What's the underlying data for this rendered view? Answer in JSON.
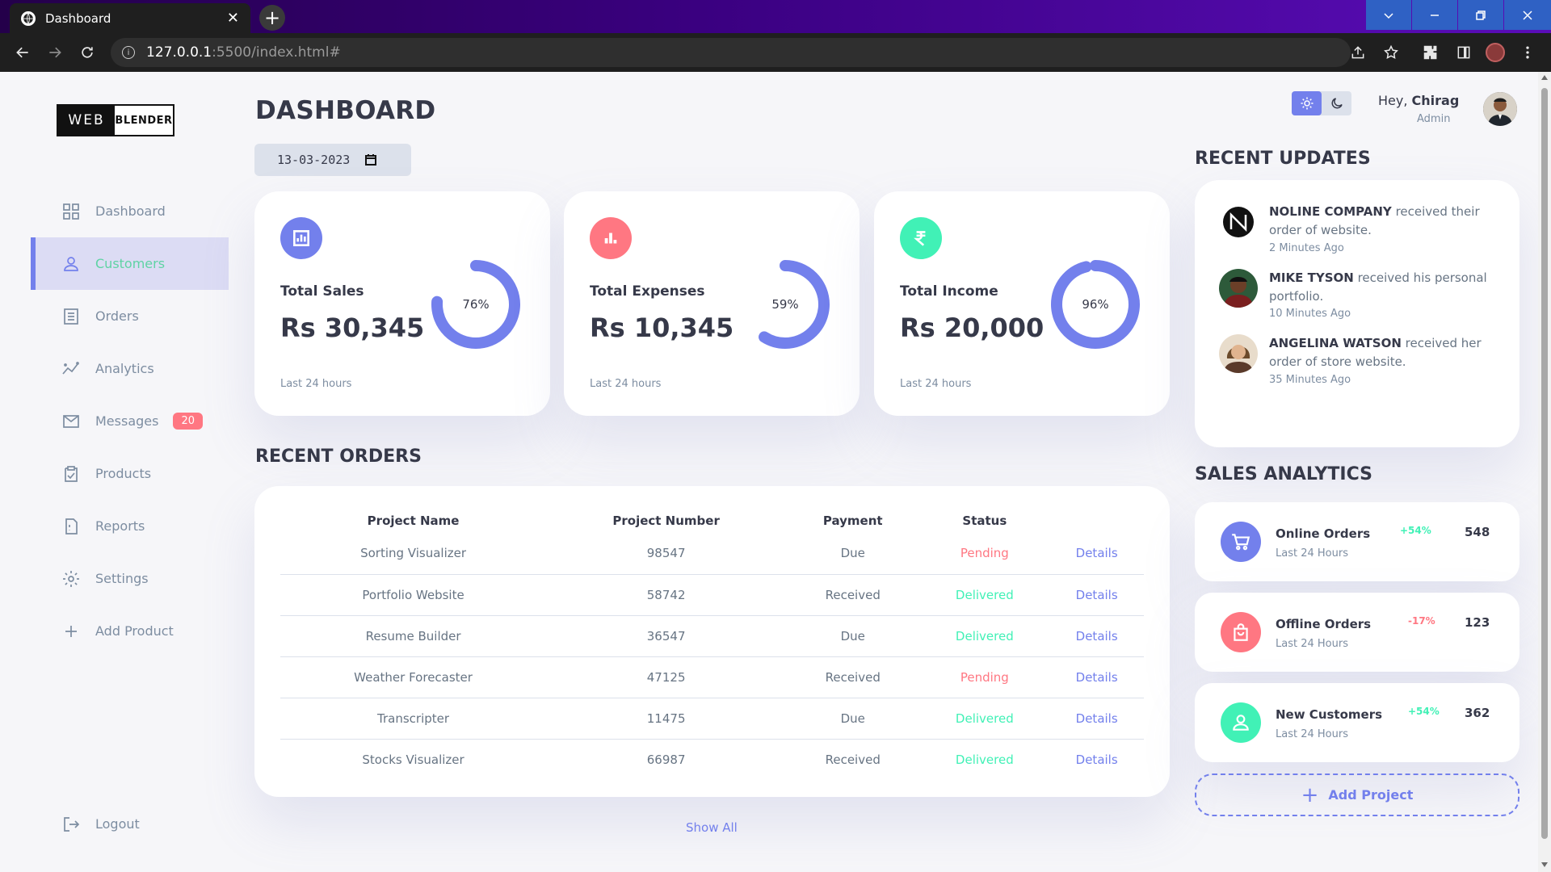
{
  "browser": {
    "tab_title": "Dashboard",
    "tab_close": "✕",
    "new_tab": "+",
    "url_host": "127.0.0.1",
    "url_path": ":5500/index.html#"
  },
  "logo": {
    "part1": "WEB",
    "part2": "BLENDER"
  },
  "sidebar": {
    "items": [
      {
        "label": "Dashboard",
        "icon": "grid-icon"
      },
      {
        "label": "Customers",
        "icon": "person-icon"
      },
      {
        "label": "Orders",
        "icon": "receipt-icon"
      },
      {
        "label": "Analytics",
        "icon": "insights-icon"
      },
      {
        "label": "Messages",
        "icon": "mail-icon",
        "badge": "20"
      },
      {
        "label": "Products",
        "icon": "inventory-icon"
      },
      {
        "label": "Reports",
        "icon": "report-icon"
      },
      {
        "label": "Settings",
        "icon": "gear-icon"
      },
      {
        "label": "Add Product",
        "icon": "plus-icon"
      }
    ],
    "active_index": 1,
    "logout": "Logout"
  },
  "main": {
    "title": "DASHBOARD",
    "date": "13-03-2023",
    "cards": [
      {
        "title": "Total Sales",
        "value": "Rs 30,345",
        "percent_label": "76%",
        "percent": 76,
        "footer": "Last 24 hours",
        "color": "#7380ec",
        "icon": "analytics-icon"
      },
      {
        "title": "Total Expenses",
        "value": "Rs 10,345",
        "percent_label": "59%",
        "percent": 59,
        "footer": "Last 24 hours",
        "color": "#ff7782",
        "icon": "bar-chart-icon"
      },
      {
        "title": "Total Income",
        "value": "Rs 20,000",
        "percent_label": "96%",
        "percent": 96,
        "footer": "Last 24 hours",
        "color": "#41f1b6",
        "icon": "rupee-icon"
      }
    ],
    "orders_title": "RECENT ORDERS",
    "orders_headers": [
      "Project Name",
      "Project Number",
      "Payment",
      "Status",
      ""
    ],
    "orders": [
      {
        "name": "Sorting Visualizer",
        "number": "98547",
        "payment": "Due",
        "status": "Pending",
        "details": "Details"
      },
      {
        "name": "Portfolio Website",
        "number": "58742",
        "payment": "Received",
        "status": "Delivered",
        "details": "Details"
      },
      {
        "name": "Resume Builder",
        "number": "36547",
        "payment": "Due",
        "status": "Delivered",
        "details": "Details"
      },
      {
        "name": "Weather Forecaster",
        "number": "47125",
        "payment": "Received",
        "status": "Pending",
        "details": "Details"
      },
      {
        "name": "Transcripter",
        "number": "11475",
        "payment": "Due",
        "status": "Delivered",
        "details": "Details"
      },
      {
        "name": "Stocks Visualizer",
        "number": "66987",
        "payment": "Received",
        "status": "Delivered",
        "details": "Details"
      }
    ],
    "show_all": "Show All"
  },
  "header": {
    "greeting": "Hey, ",
    "user_name": "Chirag",
    "role": "Admin"
  },
  "updates": {
    "title": "RECENT UPDATES",
    "items": [
      {
        "name": "NOLINE COMPANY",
        "text": " received their order of website.",
        "time": "2 Minutes Ago"
      },
      {
        "name": "MIKE TYSON",
        "text": " received his personal portfolio.",
        "time": "10 Minutes Ago"
      },
      {
        "name": "ANGELINA WATSON",
        "text": " received her order of store website.",
        "time": "35 Minutes Ago"
      }
    ]
  },
  "analytics": {
    "title": "SALES ANALYTICS",
    "items": [
      {
        "title": "Online Orders",
        "sub": "Last 24 Hours",
        "pct": "+54%",
        "value": "548",
        "color": "#7380ec",
        "pct_color": "#41f1b6",
        "icon": "cart-icon"
      },
      {
        "title": "Offline Orders",
        "sub": "Last 24 Hours",
        "pct": "-17%",
        "value": "123",
        "color": "#ff7782",
        "pct_color": "#ff7782",
        "icon": "shopping-bag-icon"
      },
      {
        "title": "New Customers",
        "sub": "Last 24 Hours",
        "pct": "+54%",
        "value": "362",
        "color": "#41f1b6",
        "pct_color": "#41f1b6",
        "icon": "person-icon"
      }
    ],
    "add_project": "Add Project"
  }
}
